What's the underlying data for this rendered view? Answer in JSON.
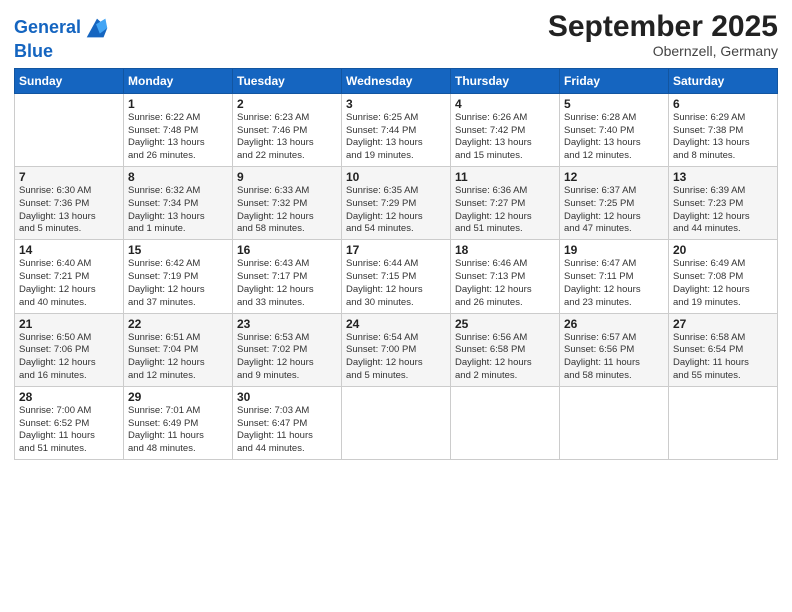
{
  "logo": {
    "line1": "General",
    "line2": "Blue"
  },
  "title": "September 2025",
  "location": "Obernzell, Germany",
  "weekdays": [
    "Sunday",
    "Monday",
    "Tuesday",
    "Wednesday",
    "Thursday",
    "Friday",
    "Saturday"
  ],
  "weeks": [
    [
      {
        "day": "",
        "info": ""
      },
      {
        "day": "1",
        "info": "Sunrise: 6:22 AM\nSunset: 7:48 PM\nDaylight: 13 hours\nand 26 minutes."
      },
      {
        "day": "2",
        "info": "Sunrise: 6:23 AM\nSunset: 7:46 PM\nDaylight: 13 hours\nand 22 minutes."
      },
      {
        "day": "3",
        "info": "Sunrise: 6:25 AM\nSunset: 7:44 PM\nDaylight: 13 hours\nand 19 minutes."
      },
      {
        "day": "4",
        "info": "Sunrise: 6:26 AM\nSunset: 7:42 PM\nDaylight: 13 hours\nand 15 minutes."
      },
      {
        "day": "5",
        "info": "Sunrise: 6:28 AM\nSunset: 7:40 PM\nDaylight: 13 hours\nand 12 minutes."
      },
      {
        "day": "6",
        "info": "Sunrise: 6:29 AM\nSunset: 7:38 PM\nDaylight: 13 hours\nand 8 minutes."
      }
    ],
    [
      {
        "day": "7",
        "info": "Sunrise: 6:30 AM\nSunset: 7:36 PM\nDaylight: 13 hours\nand 5 minutes."
      },
      {
        "day": "8",
        "info": "Sunrise: 6:32 AM\nSunset: 7:34 PM\nDaylight: 13 hours\nand 1 minute."
      },
      {
        "day": "9",
        "info": "Sunrise: 6:33 AM\nSunset: 7:32 PM\nDaylight: 12 hours\nand 58 minutes."
      },
      {
        "day": "10",
        "info": "Sunrise: 6:35 AM\nSunset: 7:29 PM\nDaylight: 12 hours\nand 54 minutes."
      },
      {
        "day": "11",
        "info": "Sunrise: 6:36 AM\nSunset: 7:27 PM\nDaylight: 12 hours\nand 51 minutes."
      },
      {
        "day": "12",
        "info": "Sunrise: 6:37 AM\nSunset: 7:25 PM\nDaylight: 12 hours\nand 47 minutes."
      },
      {
        "day": "13",
        "info": "Sunrise: 6:39 AM\nSunset: 7:23 PM\nDaylight: 12 hours\nand 44 minutes."
      }
    ],
    [
      {
        "day": "14",
        "info": "Sunrise: 6:40 AM\nSunset: 7:21 PM\nDaylight: 12 hours\nand 40 minutes."
      },
      {
        "day": "15",
        "info": "Sunrise: 6:42 AM\nSunset: 7:19 PM\nDaylight: 12 hours\nand 37 minutes."
      },
      {
        "day": "16",
        "info": "Sunrise: 6:43 AM\nSunset: 7:17 PM\nDaylight: 12 hours\nand 33 minutes."
      },
      {
        "day": "17",
        "info": "Sunrise: 6:44 AM\nSunset: 7:15 PM\nDaylight: 12 hours\nand 30 minutes."
      },
      {
        "day": "18",
        "info": "Sunrise: 6:46 AM\nSunset: 7:13 PM\nDaylight: 12 hours\nand 26 minutes."
      },
      {
        "day": "19",
        "info": "Sunrise: 6:47 AM\nSunset: 7:11 PM\nDaylight: 12 hours\nand 23 minutes."
      },
      {
        "day": "20",
        "info": "Sunrise: 6:49 AM\nSunset: 7:08 PM\nDaylight: 12 hours\nand 19 minutes."
      }
    ],
    [
      {
        "day": "21",
        "info": "Sunrise: 6:50 AM\nSunset: 7:06 PM\nDaylight: 12 hours\nand 16 minutes."
      },
      {
        "day": "22",
        "info": "Sunrise: 6:51 AM\nSunset: 7:04 PM\nDaylight: 12 hours\nand 12 minutes."
      },
      {
        "day": "23",
        "info": "Sunrise: 6:53 AM\nSunset: 7:02 PM\nDaylight: 12 hours\nand 9 minutes."
      },
      {
        "day": "24",
        "info": "Sunrise: 6:54 AM\nSunset: 7:00 PM\nDaylight: 12 hours\nand 5 minutes."
      },
      {
        "day": "25",
        "info": "Sunrise: 6:56 AM\nSunset: 6:58 PM\nDaylight: 12 hours\nand 2 minutes."
      },
      {
        "day": "26",
        "info": "Sunrise: 6:57 AM\nSunset: 6:56 PM\nDaylight: 11 hours\nand 58 minutes."
      },
      {
        "day": "27",
        "info": "Sunrise: 6:58 AM\nSunset: 6:54 PM\nDaylight: 11 hours\nand 55 minutes."
      }
    ],
    [
      {
        "day": "28",
        "info": "Sunrise: 7:00 AM\nSunset: 6:52 PM\nDaylight: 11 hours\nand 51 minutes."
      },
      {
        "day": "29",
        "info": "Sunrise: 7:01 AM\nSunset: 6:49 PM\nDaylight: 11 hours\nand 48 minutes."
      },
      {
        "day": "30",
        "info": "Sunrise: 7:03 AM\nSunset: 6:47 PM\nDaylight: 11 hours\nand 44 minutes."
      },
      {
        "day": "",
        "info": ""
      },
      {
        "day": "",
        "info": ""
      },
      {
        "day": "",
        "info": ""
      },
      {
        "day": "",
        "info": ""
      }
    ]
  ]
}
